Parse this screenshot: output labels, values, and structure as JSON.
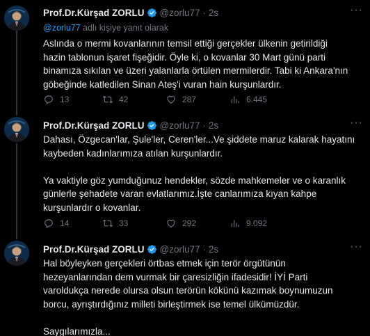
{
  "author": {
    "name": "Prof.Dr.Kürşad ZORLU",
    "handle": "@zorlu77",
    "separator": "·"
  },
  "colors": {
    "background": "#000000",
    "text": "#e7e9ea",
    "muted": "#71767b",
    "accent": "#1d9bf0",
    "divider": "#2f3336"
  },
  "tweets": [
    {
      "time": "2s",
      "reply_to": {
        "mention": "@zorlu77",
        "suffix": " adlı kişiye yanıt olarak"
      },
      "lines": [
        "Aslında o mermi kovanlarının temsil ettiği gerçekler ülkenin getirildiği",
        "hazin tablonun işaret fişeğidir. Öyle ki, o kovanlar 30 Mart günü parti",
        "binamıza sıkılan ve üzeri yalanlarla örtülen mermilerdir. Tabi ki Ankara'nın",
        "göbeğinde katledilen Sinan Ateş'i vuran hain kurşunlardır."
      ],
      "stats": {
        "replies": "13",
        "retweets": "42",
        "likes": "287",
        "views": "6.445"
      }
    },
    {
      "time": "2s",
      "lines": [
        "Dahası, Özgecan'lar, Şule'ler, Ceren'ler...Ve şiddete maruz kalarak hayatını",
        "kaybeden kadınlarımıza atılan kurşunlardır.",
        "",
        "Ya vaktiyle göz yumduğunuz hendekler, sözde mahkemeler ve o karanlık",
        "günlerle şehadete varan evlatlarımız.İşte canlarımıza kıyan kahpe",
        "kurşunlardır o kovanlar."
      ],
      "stats": {
        "replies": "14",
        "retweets": "33",
        "likes": "292",
        "views": "9.092"
      }
    },
    {
      "time": "2s",
      "lines": [
        "Hal böyleyken gerçekleri örtbas etmek için terör örgütünün",
        "hezeyanlarından dem vurmak bir çaresizliğin ifadesidir! İYİ Parti",
        "varoldukça nerede olursa olsun terörün kökünü kazımak boynumuzun",
        "borcu, ayrıştırdığınız milleti birleştirmek ise temel ülkümüzdür.",
        "",
        "Saygılarımızla..."
      ]
    }
  ],
  "icons": {
    "more": "more-dots-icon",
    "verified": "verified-badge-icon",
    "reply": "reply-icon",
    "retweet": "retweet-icon",
    "like": "heart-icon",
    "views": "views-chart-icon"
  }
}
